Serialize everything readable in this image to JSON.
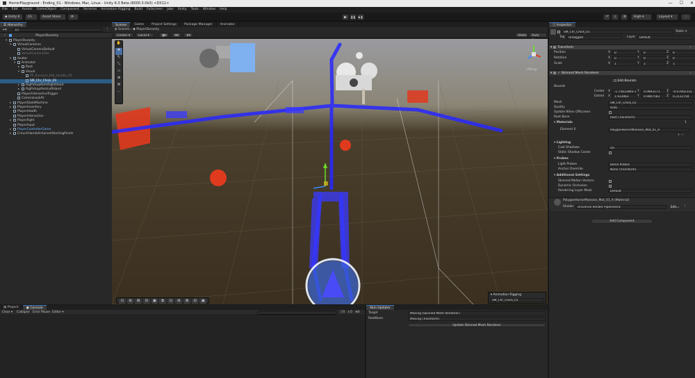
{
  "window": {
    "title": "HorrorPlayground - Ending_01 - Windows, Mac, Linux - Unity 6.3 Beta (6000.3.0b3) <DX11>",
    "controls": [
      "—",
      "☐",
      "✕"
    ]
  },
  "menu": [
    "File",
    "Edit",
    "Assets",
    "GameObject",
    "Component",
    "Services",
    "Animation Rigging",
    "Build",
    "Fullscreen",
    "Jobs",
    "Sinity",
    "Tools",
    "Window",
    "Help"
  ],
  "toolbar": {
    "account": "Unity 6",
    "cloud": "Cli",
    "asset_store": "Asset Store",
    "play": "▶",
    "pause": "❚❚",
    "step": "▶❚",
    "layout": "Layout",
    "quality": "High"
  },
  "hierarchy": {
    "tab": "Hierarchy",
    "search_placeholder": "All",
    "root": "PlayerDuranty",
    "rows": [
      {
        "label": "PlayerDuranty",
        "indent": 1,
        "tri": "▾"
      },
      {
        "label": "VirtualCameras",
        "indent": 2,
        "tri": "▾"
      },
      {
        "label": "VirtualCameraDefault",
        "indent": 3,
        "tri": ""
      },
      {
        "label": "VirtualCameraAim",
        "indent": 3,
        "tri": "",
        "dim": true
      },
      {
        "label": "Avatar",
        "indent": 2,
        "tri": "▾"
      },
      {
        "label": "Animator",
        "indent": 3,
        "tri": "▾"
      },
      {
        "label": "Root",
        "indent": 4,
        "tri": "▸"
      },
      {
        "label": "Visual",
        "indent": 4,
        "tri": "▾"
      },
      {
        "label": "PF_Survivor_Hat_Hoodie_01",
        "indent": 5,
        "tri": "",
        "dim": true
      },
      {
        "label": "SM_Chr_Chick_01",
        "indent": 5,
        "tri": "",
        "sel": true
      },
      {
        "label": "RigPickupItemRightHand",
        "indent": 4,
        "tri": "▸"
      },
      {
        "label": "RigPickupItemLeftHand",
        "indent": 4,
        "tri": "▸"
      },
      {
        "label": "PlayerInteractiveTrigger",
        "indent": 3,
        "tri": ""
      },
      {
        "label": "CameraLookAt",
        "indent": 3,
        "tri": ""
      },
      {
        "label": "PlayerStateMachine",
        "indent": 2,
        "tri": "▸"
      },
      {
        "label": "PlayerInventory",
        "indent": 2,
        "tri": "▸"
      },
      {
        "label": "PlayerHealth",
        "indent": 2,
        "tri": ""
      },
      {
        "label": "PlayerInteraction",
        "indent": 2,
        "tri": ""
      },
      {
        "label": "PlayerFight",
        "indent": 2,
        "tri": "▸"
      },
      {
        "label": "PlayerInput",
        "indent": 2,
        "tri": ""
      },
      {
        "label": "PlayerControllerGame",
        "indent": 2,
        "tri": "▸",
        "blue": true
      },
      {
        "label": "CrouchHandsActionsetStartingPoints",
        "indent": 2,
        "tri": "▸"
      }
    ]
  },
  "scene": {
    "tabs": [
      "Scenes",
      "Game",
      "Project Settings",
      "Package Manager",
      "Animator"
    ],
    "breadcrumb": [
      "Scenes",
      "PlayerDuranty"
    ],
    "pivot": "Center",
    "space": "Local",
    "auto_save": "Auto Save",
    "static": "Static",
    "persp": "<Persp",
    "overlay_title": "Animation Rigging",
    "overlay_value": "SM_Chr_Chick_01"
  },
  "project": {
    "tabs": [
      "Project",
      "Console"
    ],
    "buttons": [
      "Clear",
      "Collapse",
      "Error Pause",
      "Editor"
    ],
    "counts": [
      "0",
      "0",
      "0"
    ]
  },
  "skin": {
    "tab": "Skin Updater",
    "rows": [
      {
        "label": "Target",
        "value": "Missing (Skinned Mesh Renderer)"
      },
      {
        "label": "RootBone",
        "value": "Missing (Transform)"
      }
    ],
    "button": "Update Skinned Mesh Renderer"
  },
  "inspector": {
    "tab": "Inspector",
    "object_name": "SM_Chr_Chick_01",
    "static_label": "Static",
    "tag_label": "Tag",
    "tag_value": "Untagged",
    "layer_label": "Layer",
    "layer_value": "Default",
    "transform": {
      "title": "Transform",
      "rows": [
        {
          "label": "Position",
          "x": "0",
          "y": "0",
          "z": "0"
        },
        {
          "label": "Rotation",
          "x": "0",
          "y": "0",
          "z": "0"
        },
        {
          "label": "Scale",
          "x": "1",
          "y": "1",
          "z": "1"
        }
      ]
    },
    "smr": {
      "title": "Skinned Mesh Renderer",
      "edit_bounds": "Edit Bounds",
      "bounds": "Bounds",
      "center_label": "Center",
      "center": [
        "-1.7581384e-10",
        "0.0893273",
        "-0.07602333"
      ],
      "extent_label": "Extent",
      "extent": [
        "1.933983",
        "0.9807583",
        "0.3133758"
      ],
      "mesh_label": "Mesh",
      "mesh": "SM_Chr_Chick_01",
      "quality_label": "Quality",
      "quality": "Auto",
      "update_label": "Update When Offscreen",
      "rootbone_label": "Root Bone",
      "rootbone": "Root (Transform)",
      "materials_label": "Materials",
      "materials_count": "1",
      "element_label": "Element 0",
      "element_value": "PolygonHorrorMansion_Mat_01_A",
      "lighting": "Lighting",
      "cast_label": "Cast Shadows",
      "cast": "On",
      "static_shadow": "Static Shadow Caster",
      "probes": "Probes",
      "light_probes_label": "Light Probes",
      "light_probes": "Blend Probes",
      "anchor_label": "Anchor Override",
      "anchor": "None (Transform)",
      "additional": "Additional Settings",
      "motion": "Skinned Motion Vectors",
      "occlusion": "Dynamic Occlusion",
      "rlm_label": "Rendering Layer Mask",
      "rlm": "Default"
    },
    "material": {
      "name": "PolygonHorrorMansion_Mat_01_A (Material)",
      "shader_label": "Shader",
      "shader": "Universal Render Pipeline/Lit",
      "edit": "Edit..."
    },
    "add_component": "Add Component"
  },
  "colors": {
    "accent": "#3a79bb",
    "selection": "#2c5d87",
    "bone": "#2828ff",
    "red": "#e03a1e"
  }
}
